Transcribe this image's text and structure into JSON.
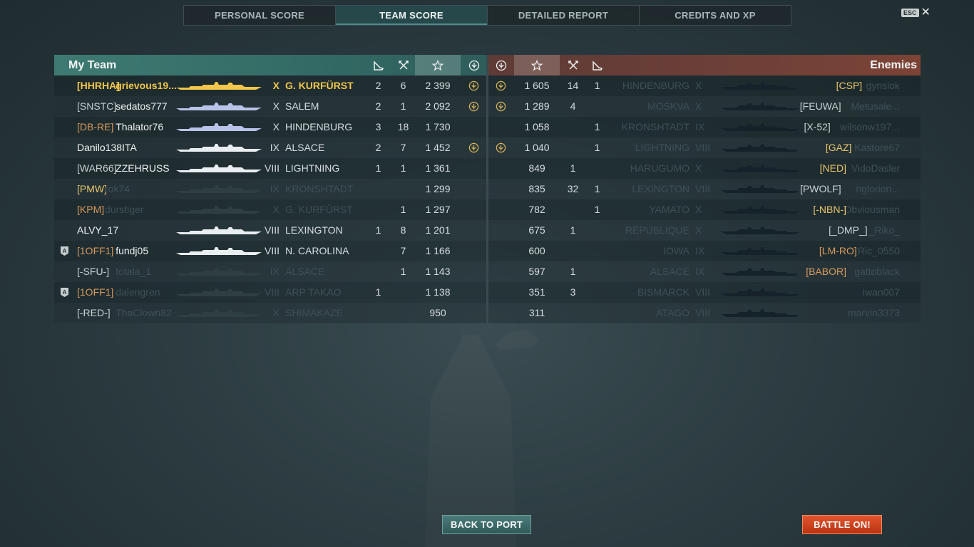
{
  "tabs": [
    {
      "label": "PERSONAL SCORE",
      "active": false
    },
    {
      "label": "TEAM SCORE",
      "active": true
    },
    {
      "label": "DETAILED REPORT",
      "active": false
    },
    {
      "label": "CREDITS AND XP",
      "active": false
    }
  ],
  "esc": {
    "key": "ESC",
    "close": "✕"
  },
  "my_team": {
    "title": "My Team",
    "columns": [
      "planes-destroyed-icon",
      "kills-icon",
      "base-xp-star-icon",
      "achievement-icon"
    ],
    "rows": [
      {
        "badge": "",
        "clan": "[HHRHA]",
        "clan_color": "gold",
        "name": "grievous19...",
        "tier": "X",
        "ship": "G. KURFÜRST",
        "planes": "2",
        "kills": "6",
        "score": "2 399",
        "medal": true,
        "state": "me"
      },
      {
        "badge": "",
        "clan": "[SNSTC]",
        "clan_color": "grey",
        "name": "sedatos777",
        "tier": "X",
        "ship": "SALEM",
        "planes": "2",
        "kills": "1",
        "score": "2 092",
        "medal": true,
        "state": "alive"
      },
      {
        "badge": "",
        "clan": "[DB-RE]",
        "clan_color": "orange",
        "name": "Thalator76",
        "tier": "X",
        "ship": "HINDENBURG",
        "planes": "3",
        "kills": "18",
        "score": "1 730",
        "medal": false,
        "state": "alive"
      },
      {
        "badge": "",
        "clan": "",
        "clan_color": "grey",
        "name": "Danilo138ITA",
        "tier": "IX",
        "ship": "ALSACE",
        "planes": "2",
        "kills": "7",
        "score": "1 452",
        "medal": true,
        "state": "alive"
      },
      {
        "badge": "",
        "clan": "[WAR66]",
        "clan_color": "grey",
        "name": "ZZEHRUSS",
        "tier": "VIII",
        "ship": "LIGHTNING",
        "planes": "1",
        "kills": "1",
        "score": "1 361",
        "medal": false,
        "state": "alive"
      },
      {
        "badge": "",
        "clan": "[PMW]",
        "clan_color": "gold",
        "name": "rok74",
        "tier": "IX",
        "ship": "KRONSHTADT",
        "planes": "",
        "kills": "",
        "score": "1 299",
        "medal": false,
        "state": "dead"
      },
      {
        "badge": "",
        "clan": "[KPM]",
        "clan_color": "orange",
        "name": "durstiger",
        "tier": "X",
        "ship": "G. KURFÜRST",
        "planes": "",
        "kills": "1",
        "score": "1 297",
        "medal": false,
        "state": "dead"
      },
      {
        "badge": "",
        "clan": "",
        "clan_color": "grey",
        "name": "ALVY_17",
        "tier": "VIII",
        "ship": "LEXINGTON",
        "planes": "1",
        "kills": "8",
        "score": "1 201",
        "medal": false,
        "state": "alive"
      },
      {
        "badge": "A",
        "clan": "[1OFF1]",
        "clan_color": "orange",
        "name": "fundj05",
        "tier": "VIII",
        "ship": "N. CAROLINA",
        "planes": "",
        "kills": "7",
        "score": "1 166",
        "medal": false,
        "state": "alive"
      },
      {
        "badge": "",
        "clan": "[-SFU-]",
        "clan_color": "grey",
        "name": "totala_1",
        "tier": "IX",
        "ship": "ALSACE",
        "planes": "",
        "kills": "1",
        "score": "1 143",
        "medal": false,
        "state": "dead"
      },
      {
        "badge": "A",
        "clan": "[1OFF1]",
        "clan_color": "orange",
        "name": "dalengren",
        "tier": "VIII",
        "ship": "ARP TAKAO",
        "planes": "1",
        "kills": "",
        "score": "1 138",
        "medal": false,
        "state": "dead"
      },
      {
        "badge": "",
        "clan": "[-RED-]",
        "clan_color": "grey",
        "name": "ThaClown82",
        "tier": "X",
        "ship": "SHIMAKAZE",
        "planes": "",
        "kills": "",
        "score": "950",
        "medal": false,
        "state": "dead"
      }
    ]
  },
  "enemies": {
    "title": "Enemies",
    "rows": [
      {
        "medal": true,
        "score": "1 605",
        "kills": "14",
        "planes": "1",
        "ship": "HINDENBURG",
        "tier": "X",
        "clan": "[CSP]",
        "clan_color": "gold",
        "name": "gynsiok",
        "state": "dead"
      },
      {
        "medal": true,
        "score": "1 289",
        "kills": "4",
        "planes": "",
        "ship": "MOSKVA",
        "tier": "X",
        "clan": "[FEUWA]",
        "clan_color": "grey",
        "name": "Metusale...",
        "state": "dead"
      },
      {
        "medal": false,
        "score": "1 058",
        "kills": "",
        "planes": "1",
        "ship": "KRONSHTADT",
        "tier": "IX",
        "clan": "[X-52]",
        "clan_color": "grey",
        "name": "wilsonw197...",
        "state": "dead"
      },
      {
        "medal": true,
        "score": "1 040",
        "kills": "",
        "planes": "1",
        "ship": "LIGHTNING",
        "tier": "VIII",
        "clan": "[GAZ]",
        "clan_color": "gold",
        "name": "Kastore67",
        "state": "dead"
      },
      {
        "medal": false,
        "score": "849",
        "kills": "1",
        "planes": "",
        "ship": "HARUGUMO",
        "tier": "X",
        "clan": "[NED]",
        "clan_color": "gold",
        "name": "VidoDasler",
        "state": "dead"
      },
      {
        "medal": false,
        "score": "835",
        "kills": "32",
        "planes": "1",
        "ship": "LEXINGTON",
        "tier": "VIII",
        "clan": "[PWOLF]",
        "clan_color": "grey",
        "name": "nglorion...",
        "state": "dead"
      },
      {
        "medal": false,
        "score": "782",
        "kills": "",
        "planes": "1",
        "ship": "YAMATO",
        "tier": "X",
        "clan": "[-NBN-]",
        "clan_color": "gold",
        "name": "Obviousman",
        "state": "dead"
      },
      {
        "medal": false,
        "score": "675",
        "kills": "1",
        "planes": "",
        "ship": "RÉPUBLIQUE",
        "tier": "X",
        "clan": "[_DMP_]",
        "clan_color": "grey",
        "name": "_Riko_",
        "state": "dead"
      },
      {
        "medal": false,
        "score": "600",
        "kills": "",
        "planes": "",
        "ship": "IOWA",
        "tier": "IX",
        "clan": "[LM-RO]",
        "clan_color": "orange",
        "name": "Ric_0550",
        "state": "dead"
      },
      {
        "medal": false,
        "score": "597",
        "kills": "1",
        "planes": "",
        "ship": "ALSACE",
        "tier": "IX",
        "clan": "[BABOR]",
        "clan_color": "orange",
        "name": "gattoblack",
        "state": "dead"
      },
      {
        "medal": false,
        "score": "351",
        "kills": "3",
        "planes": "",
        "ship": "BISMARCK",
        "tier": "VIII",
        "clan": "",
        "clan_color": "grey",
        "name": "iwan007",
        "state": "dead"
      },
      {
        "medal": false,
        "score": "311",
        "kills": "",
        "planes": "",
        "ship": "ATAGO",
        "tier": "VIII",
        "clan": "",
        "clan_color": "grey",
        "name": "marvin3373",
        "state": "dead"
      }
    ]
  },
  "buttons": {
    "back_to_port": "BACK TO PORT",
    "battle_on": "BATTLE ON!"
  },
  "colors": {
    "accent_team": "#3e7a72",
    "accent_enemy": "#7c4336",
    "highlight_player": "#f1c64a",
    "battle_button": "#d2451f"
  }
}
